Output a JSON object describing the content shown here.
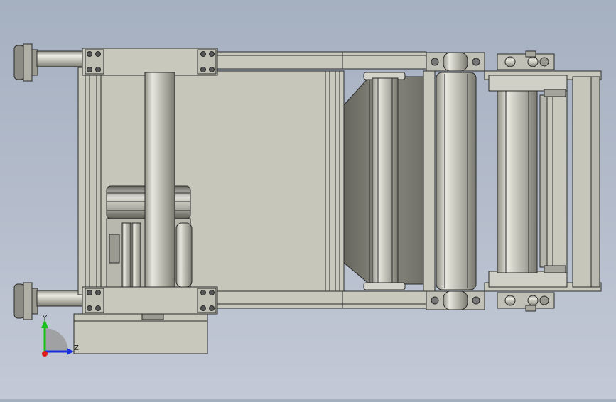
{
  "viewport": {
    "background_top": "#a5b0c0",
    "background_bottom": "#c3c9d6",
    "model_face_color": "#c8c8bc",
    "model_edge_color": "#2a2a2a"
  },
  "triad": {
    "y_label": "Y",
    "z_label": "Z",
    "y_axis_color": "#19c019",
    "z_axis_color": "#1a2fe0",
    "x_axis_color": "#e01919",
    "x_axis_icon": "x-axis-dot-icon",
    "y_axis_icon": "y-axis-arrow-icon",
    "z_axis_icon": "z-axis-arrow-icon"
  }
}
